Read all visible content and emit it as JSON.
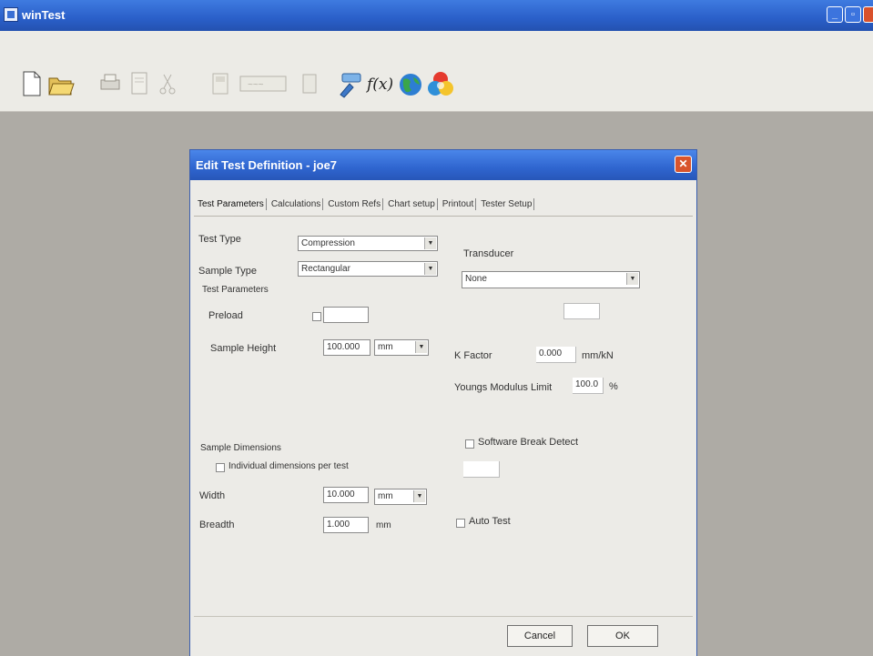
{
  "app": {
    "title": "winTest"
  },
  "dialog": {
    "title": "Edit Test Definition - joe7",
    "tabs": [
      "Test Parameters",
      "Calculations",
      "Custom Refs",
      "Chart setup",
      "Printout",
      "Tester Setup"
    ],
    "active_tab": "Test Parameters"
  },
  "test_type": {
    "label": "Test Type",
    "value": "Compression"
  },
  "sample_type": {
    "label": "Sample Type",
    "value": "Rectangular"
  },
  "transducer": {
    "label": "Transducer",
    "value": "None"
  },
  "test_parameters": {
    "heading": "Test Parameters",
    "preload_label": "Preload",
    "preload_value": "",
    "sample_height_label": "Sample Height",
    "sample_height_value": "100.000",
    "sample_height_unit": "mm"
  },
  "k_factor": {
    "label": "K Factor",
    "value": "0.000",
    "unit": "mm/kN"
  },
  "youngs_modulus": {
    "label": "Youngs Modulus Limit",
    "value": "100.0",
    "unit": "%"
  },
  "software_break": {
    "label": "Software Break Detect",
    "value": ""
  },
  "sample_dimensions": {
    "heading": "Sample Dimensions",
    "individual_label": "Individual dimensions per test",
    "width_label": "Width",
    "width_value": "10.000",
    "width_unit": "mm",
    "breadth_label": "Breadth",
    "breadth_value": "1.000",
    "breadth_unit": "mm"
  },
  "auto_test": {
    "label": "Auto Test"
  },
  "buttons": {
    "cancel": "Cancel",
    "ok": "OK"
  },
  "icons": [
    "new-file-icon",
    "open-folder-icon",
    "print-icon",
    "page-icon",
    "cut-icon",
    "gauge-icon",
    "calibrate-icon",
    "save-icon",
    "tools-icon",
    "function-icon",
    "globe-icon",
    "color-wheel-icon"
  ]
}
